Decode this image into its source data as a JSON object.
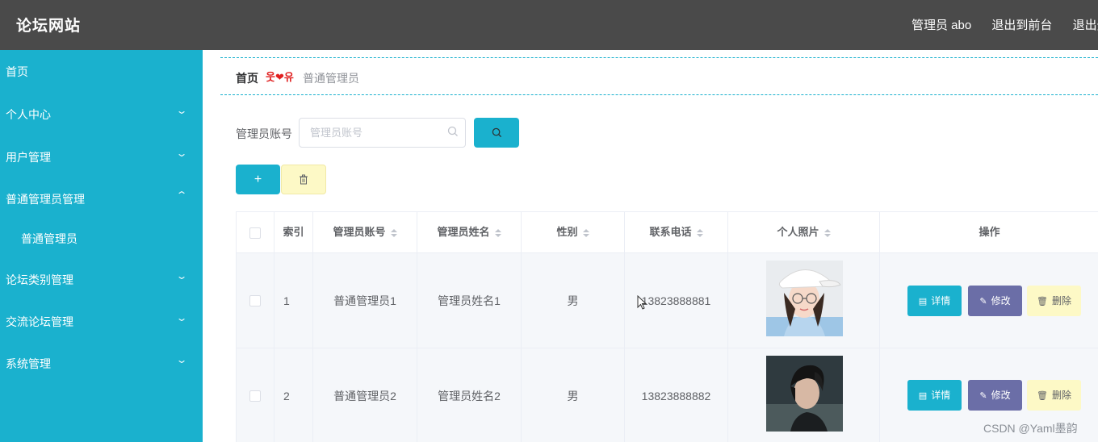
{
  "header": {
    "site_title": "论坛网站",
    "links": [
      "管理员 abo",
      "退出到前台",
      "退出登"
    ]
  },
  "sidebar": {
    "items": [
      {
        "label": "首页",
        "chevron": ""
      },
      {
        "label": "个人中心",
        "chevron": "⌄"
      },
      {
        "label": "用户管理",
        "chevron": "⌄"
      },
      {
        "label": "普通管理员管理",
        "chevron": "⌃"
      },
      {
        "label": "论坛类别管理",
        "chevron": "⌄"
      },
      {
        "label": "交流论坛管理",
        "chevron": "⌄"
      },
      {
        "label": "系统管理",
        "chevron": "⌄"
      }
    ],
    "subitems": [
      "普通管理员"
    ]
  },
  "breadcrumb": {
    "home": "首页",
    "separator": "웃❤유",
    "current": "普通管理员"
  },
  "search": {
    "label": "管理员账号",
    "placeholder": "管理员账号",
    "value": ""
  },
  "toolbar": {
    "add_label": "+"
  },
  "table": {
    "columns": [
      "",
      "索引",
      "管理员账号",
      "管理员姓名",
      "性别",
      "联系电话",
      "个人照片",
      "操作"
    ],
    "rows": [
      {
        "index": "1",
        "account": "普通管理员1",
        "name": "管理员姓名1",
        "gender": "男",
        "phone": "13823888881",
        "photo": "female-portrait"
      },
      {
        "index": "2",
        "account": "普通管理员2",
        "name": "管理员姓名2",
        "gender": "男",
        "phone": "13823888882",
        "photo": "male-portrait"
      }
    ],
    "actions": {
      "detail": "详情",
      "edit": "修改",
      "delete": "删除"
    }
  },
  "watermark": "CSDN @Yaml墨韵",
  "colors": {
    "accent": "#1ab1ce",
    "header_bg": "#4a4a4a",
    "edit": "#6b6ea7",
    "delete": "#fdf9c6"
  }
}
